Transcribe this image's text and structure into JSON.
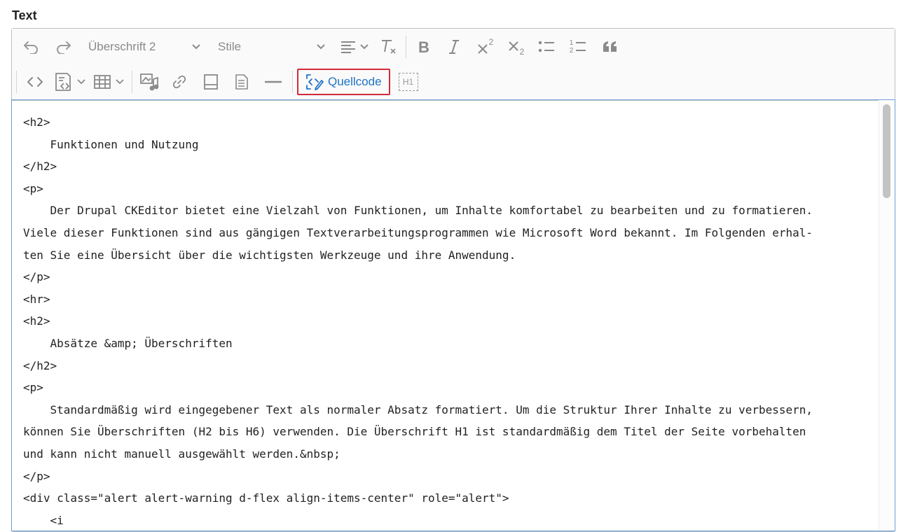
{
  "field_label": "Text",
  "toolbar": {
    "undo_icon": "undo-icon",
    "redo_icon": "redo-icon",
    "heading_value": "Überschrift 2",
    "style_value": "Stile",
    "source_label": "Quellcode",
    "h1_label": "H1",
    "superscript_digit": "2",
    "subscript_digit": "2",
    "numbered_1": "1",
    "numbered_2": "2"
  },
  "source_lines": [
    "<h2>",
    "    Funktionen und Nutzung",
    "</h2>",
    "<p>",
    "    Der Drupal CKEditor bietet eine Vielzahl von Funktionen, um Inhalte komfortabel zu bearbeiten und zu formatieren.",
    "Viele dieser Funktionen sind aus gängigen Textverarbeitungsprogrammen wie Microsoft Word bekannt. Im Folgenden erhal-",
    "ten Sie eine Übersicht über die wichtigsten Werkzeuge und ihre Anwendung.",
    "</p>",
    "<hr>",
    "<h2>",
    "    Absätze &amp; Überschriften",
    "</h2>",
    "<p>",
    "    Standardmäßig wird eingegebener Text als normaler Absatz formatiert. Um die Struktur Ihrer Inhalte zu verbessern,",
    "können Sie Überschriften (H2 bis H6) verwenden. Die Überschrift H1 ist standardmäßig dem Titel der Seite vorbehalten",
    "und kann nicht manuell ausgewählt werden.&nbsp;",
    "</p>",
    "<div class=\"alert alert-warning d-flex align-items-center\" role=\"alert\">",
    "    <i"
  ],
  "colors": {
    "accent": "#1f73c6",
    "highlight_border": "#d32a3a",
    "icon_gray": "#8a8a8a"
  }
}
